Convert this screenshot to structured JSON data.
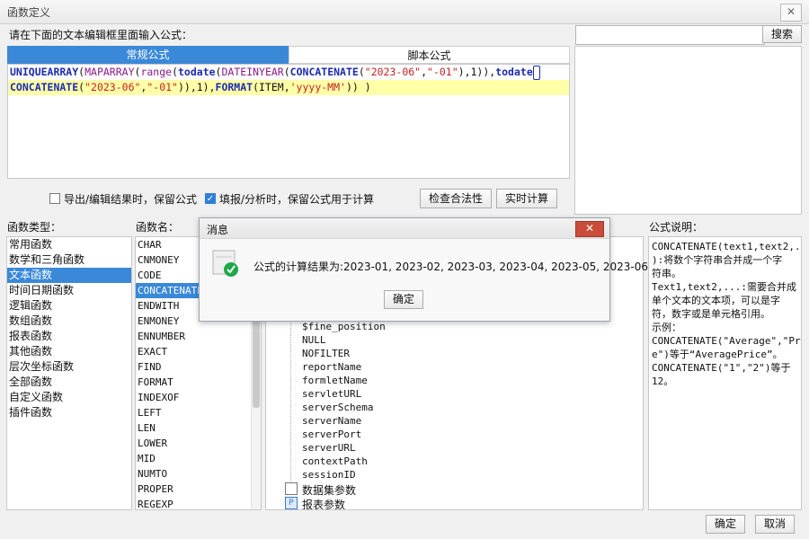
{
  "window": {
    "title": "函数定义",
    "close_glyph": "✕"
  },
  "prompt": "请在下面的文本编辑框里面输入公式：",
  "search": {
    "value": "",
    "button": "搜索"
  },
  "tabs": [
    {
      "label": "常规公式"
    },
    {
      "label": "脚本公式"
    }
  ],
  "formula": {
    "line1": [
      {
        "t": "UNIQUEARRAY",
        "c": "kw"
      },
      {
        "t": "(",
        "c": "num"
      },
      {
        "t": "MAPARRAY",
        "c": "fn"
      },
      {
        "t": "(",
        "c": "num"
      },
      {
        "t": "range",
        "c": "fn"
      },
      {
        "t": "(",
        "c": "num"
      },
      {
        "t": "todate",
        "c": "kw"
      },
      {
        "t": "(",
        "c": "num"
      },
      {
        "t": "DATEINYEAR",
        "c": "fn"
      },
      {
        "t": "(",
        "c": "num"
      },
      {
        "t": "CONCATENATE",
        "c": "kw"
      },
      {
        "t": "(",
        "c": "num"
      },
      {
        "t": "\"2023-06\"",
        "c": "str"
      },
      {
        "t": ",",
        "c": "num"
      },
      {
        "t": "\"-01\"",
        "c": "str"
      },
      {
        "t": "),1)),",
        "c": "num"
      },
      {
        "t": "todate",
        "c": "kw"
      }
    ],
    "line2": [
      {
        "t": "CONCATENATE",
        "c": "kw"
      },
      {
        "t": "(",
        "c": "num"
      },
      {
        "t": "\"2023-06\"",
        "c": "str"
      },
      {
        "t": ",",
        "c": "num"
      },
      {
        "t": "\"-01\"",
        "c": "str"
      },
      {
        "t": ")),1),",
        "c": "num"
      },
      {
        "t": "FORMAT",
        "c": "kw"
      },
      {
        "t": "(ITEM,",
        "c": "num"
      },
      {
        "t": "'yyyy-MM'",
        "c": "str"
      },
      {
        "t": ")) )",
        "c": "num"
      }
    ]
  },
  "options": {
    "export_keep": {
      "label": "导出/编辑结果时，保留公式",
      "checked": false
    },
    "fill_keep": {
      "label": "填报/分析时，保留公式用于计算",
      "checked": true
    },
    "check_button": "检查合法性",
    "realtime_button": "实时计算"
  },
  "headers": {
    "types": "函数类型：",
    "names": "函数名：",
    "desc": "公式说明："
  },
  "function_types": [
    "常用函数",
    "数学和三角函数",
    "文本函数",
    "时间日期函数",
    "逻辑函数",
    "数组函数",
    "报表函数",
    "其他函数",
    "层次坐标函数",
    "全部函数",
    "自定义函数",
    "插件函数"
  ],
  "selected_type_index": 2,
  "function_names": [
    "CHAR",
    "CNMONEY",
    "CODE",
    "CONCATENATE",
    "ENDWITH",
    "ENMONEY",
    "ENNUMBER",
    "EXACT",
    "FIND",
    "FORMAT",
    "INDEXOF",
    "LEFT",
    "LEN",
    "LOWER",
    "MID",
    "NUMTO",
    "PROPER",
    "REGEXP"
  ],
  "selected_name_index": 3,
  "tree_items": [
    "$fine_position",
    "NULL",
    "NOFILTER",
    "reportName",
    "formletName",
    "servletURL",
    "serverSchema",
    "serverName",
    "serverPort",
    "serverURL",
    "contextPath",
    "sessionID"
  ],
  "tree_groups": [
    {
      "label": "数据集参数",
      "icon": "dataset-param-icon"
    },
    {
      "label": "报表参数",
      "icon": "report-param-icon",
      "glyph": "P"
    }
  ],
  "description": [
    "CONCATENATE(text1,text2,...",
    "):将数个字符串合并成一个字",
    "符串。",
    "Text1,text2,...:需要合并成",
    "单个文本的文本项，可以是字",
    "符，数字或是单元格引用。",
    "示例：",
    "CONCATENATE(\"Average\",\"Pric",
    "e\")等于“AveragePrice”。",
    "CONCATENATE(\"1\",\"2\")等于",
    "12。"
  ],
  "dialog": {
    "title": "消息",
    "message": "公式的计算结果为:2023-01, 2023-02, 2023-03, 2023-04, 2023-05, 2023-06",
    "ok": "确定",
    "close_glyph": "✕",
    "icon": "success-check-icon",
    "icon_color": "#1fa84a"
  },
  "footer": {
    "ok": "确定",
    "cancel": "取消"
  },
  "colors": {
    "accent": "#3a89d8",
    "keyword": "#1b2bb0",
    "function": "#8b1a8b",
    "string": "#c42323",
    "highlight": "#ffffa8",
    "dialog_close": "#c94b3a"
  }
}
